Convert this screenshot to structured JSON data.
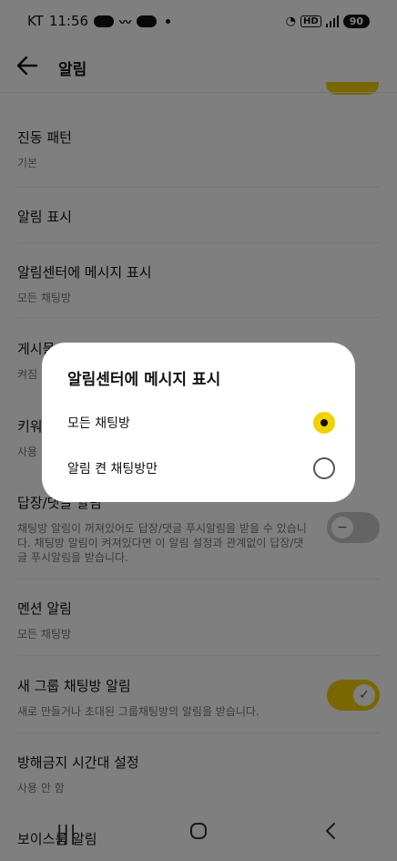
{
  "status_bar": {
    "carrier": "KT",
    "time": "11:56",
    "network_badge": "HD",
    "battery": "90"
  },
  "header": {
    "title": "알림"
  },
  "settings": [
    {
      "title": "진동 패턴",
      "subtitle": "기본"
    },
    {
      "title": "알림 표시"
    },
    {
      "title": "알림센터에 메시지 표시",
      "subtitle": "모든 채팅방"
    },
    {
      "title": "게시물",
      "subtitle": "켜짐"
    },
    {
      "title": "키워",
      "subtitle": "사용"
    },
    {
      "title": "답장/댓글 알림",
      "subtitle": "채팅방 알림이 꺼져있어도 답장/댓글 푸시알림을 받을 수 있습니다. 채팅방 알림이 켜져있다면 이 알림 설정과 관계없이 답장/댓글 푸시알림을 받습니다.",
      "toggle": "off"
    },
    {
      "title": "멘션 알림",
      "subtitle": "모든 채팅방"
    },
    {
      "title": "새 그룹 채팅방 알림",
      "subtitle": "새로 만들거나 초대된 그룹채팅방의 알림을 받습니다.",
      "toggle": "on"
    },
    {
      "title": "방해금지 시간대 설정",
      "subtitle": "사용 안 함"
    },
    {
      "title": "보이스룸 알림"
    }
  ],
  "dialog": {
    "title": "알림센터에 메시지 표시",
    "options": [
      {
        "label": "모든 채팅방",
        "selected": true
      },
      {
        "label": "알림 켠 채팅방만",
        "selected": false
      }
    ]
  },
  "icons": {
    "back": "back-arrow-icon",
    "nav_recent": "recent-apps-icon",
    "nav_home": "home-icon",
    "nav_back": "nav-back-icon"
  },
  "colors": {
    "accent": "#f2d100",
    "toggle_off": "#c9c9c9"
  }
}
